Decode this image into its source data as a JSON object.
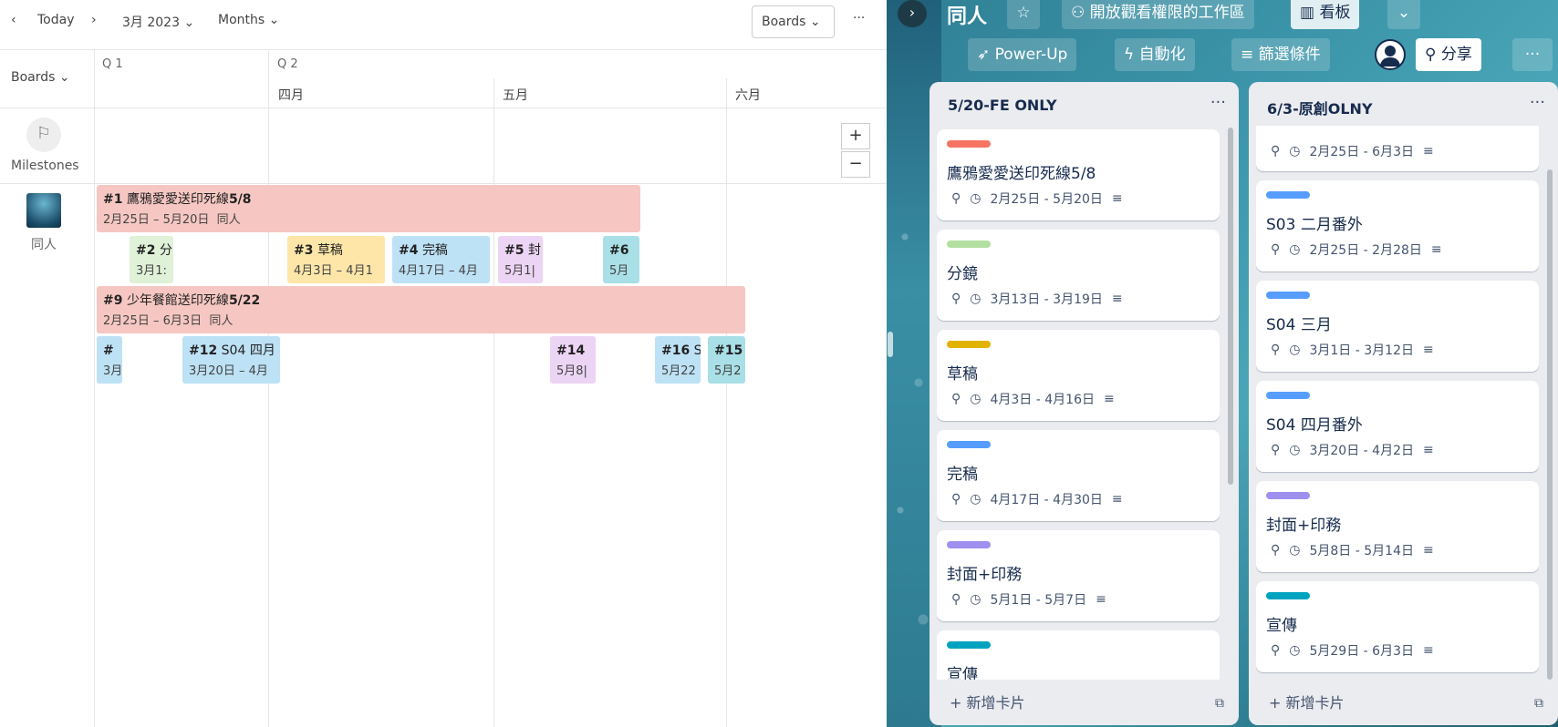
{
  "timeline": {
    "prev": "‹",
    "today": "Today",
    "next": "›",
    "month": "3月 2023",
    "view": "Months",
    "boards_btn": "Boards",
    "more": "···",
    "boards_row": "Boards",
    "q1": "Q 1",
    "q2": "Q 2",
    "months": [
      "四月",
      "五月",
      "六月"
    ],
    "milestones": "Milestones",
    "zoom_in": "+",
    "zoom_out": "−",
    "board_name": "同人",
    "bars": [
      {
        "num": "#1",
        "title": "鷹鴉愛愛送印死線",
        "bold": "5/8",
        "dates": "2月25日 – 5月20日",
        "tag": "同人",
        "color": "pink"
      },
      {
        "num": "#2",
        "title": "分",
        "bold": "",
        "dates": "3月1:",
        "tag": "",
        "color": "green"
      },
      {
        "num": "#3",
        "title": "草稿",
        "bold": "",
        "dates": "4月3日 – 4月1",
        "tag": "",
        "color": "yellow"
      },
      {
        "num": "#4",
        "title": "完稿",
        "bold": "",
        "dates": "4月17日 – 4月",
        "tag": "",
        "color": "blue"
      },
      {
        "num": "#5",
        "title": "封",
        "bold": "",
        "dates": "5月1|",
        "tag": "",
        "color": "purple"
      },
      {
        "num": "#6",
        "title": "",
        "bold": "",
        "dates": "5月",
        "tag": "",
        "color": "teal"
      },
      {
        "num": "#9",
        "title": "少年餐館送印死線",
        "bold": "5/22",
        "dates": "2月25日 – 6月3日",
        "tag": "同人",
        "color": "pink"
      },
      {
        "num": "#",
        "title": "",
        "bold": "",
        "dates": "3月",
        "tag": "",
        "color": "blue"
      },
      {
        "num": "#12",
        "title": "S04 四月",
        "bold": "",
        "dates": "3月20日 – 4月",
        "tag": "",
        "color": "blue"
      },
      {
        "num": "#14",
        "title": "",
        "bold": "",
        "dates": "5月8|",
        "tag": "",
        "color": "purple"
      },
      {
        "num": "#16",
        "title": "S",
        "bold": "",
        "dates": "5月22",
        "tag": "",
        "color": "blue"
      },
      {
        "num": "#15",
        "title": "",
        "bold": "",
        "dates": "5月2",
        "tag": "",
        "color": "teal"
      }
    ]
  },
  "board": {
    "title": "同人",
    "visibility": "開放觀看權限的工作區",
    "view": "看板",
    "powerup": "Power-Up",
    "automation": "自動化",
    "filter": "篩選條件",
    "share": "分享",
    "more": "···",
    "lists": [
      {
        "title": "5/20-FE ONLY",
        "add": "新增卡片",
        "cards": [
          {
            "label_color": "#f87462",
            "title": "鷹鴉愛愛送印死線5/8",
            "dates": "2月25日 - 5月20日"
          },
          {
            "label_color": "#b3dfa0",
            "title": "分鏡",
            "dates": "3月13日 - 3月19日"
          },
          {
            "label_color": "#e2b203",
            "title": "草稿",
            "dates": "4月3日 - 4月16日"
          },
          {
            "label_color": "#579dff",
            "title": "完稿",
            "dates": "4月17日 - 4月30日"
          },
          {
            "label_color": "#9f8fef",
            "title": "封面+印務",
            "dates": "5月1日 - 5月7日"
          },
          {
            "label_color": "#00a3bf",
            "title": "宣傳",
            "dates": ""
          }
        ]
      },
      {
        "title": "6/3-原創OLNY",
        "add": "新增卡片",
        "cards": [
          {
            "label_color": "",
            "title": "",
            "dates": "2月25日 - 6月3日"
          },
          {
            "label_color": "#579dff",
            "title": "S03 二月番外",
            "dates": "2月25日 - 2月28日"
          },
          {
            "label_color": "#579dff",
            "title": "S04 三月",
            "dates": "3月1日 - 3月12日"
          },
          {
            "label_color": "#579dff",
            "title": "S04 四月番外",
            "dates": "3月20日 - 4月2日"
          },
          {
            "label_color": "#9f8fef",
            "title": "封面+印務",
            "dates": "5月8日 - 5月14日"
          },
          {
            "label_color": "#00a3bf",
            "title": "宣傳",
            "dates": "5月29日 - 6月3日"
          }
        ]
      }
    ]
  }
}
